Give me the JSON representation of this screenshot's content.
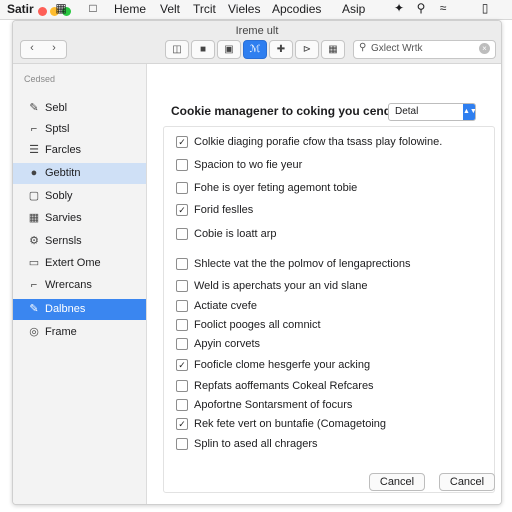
{
  "menubar": {
    "app_name": "Satir",
    "traffic_colors": [
      "#fe5f57",
      "#febc2e",
      "#28c840"
    ],
    "items": [
      "Heme",
      "Velt",
      "Trcit",
      "Vieles",
      "Apcodies",
      "Asip"
    ]
  },
  "window": {
    "title": "Ireme ult",
    "search_placeholder": "Gxlect Wrtk"
  },
  "sidebar": {
    "header": "Cedsed",
    "items": [
      {
        "label": "Sebl",
        "icon": "pencil-icon"
      },
      {
        "label": "Sptsl",
        "icon": "bracket-icon"
      },
      {
        "label": "Farcles",
        "icon": "list-icon"
      },
      {
        "label": "Gebtitn",
        "icon": "circle-icon"
      },
      {
        "label": "Sobly",
        "icon": "square-icon"
      },
      {
        "label": "Sarvies",
        "icon": "grid-icon"
      },
      {
        "label": "Sernsls",
        "icon": "gear-icon"
      },
      {
        "label": "Extert Ome",
        "icon": "document-icon"
      },
      {
        "label": "Wrercans",
        "icon": "bracket-icon"
      },
      {
        "label": "Dalbnes",
        "icon": "pencil-icon"
      },
      {
        "label": "Frame",
        "icon": "globe-icon"
      }
    ],
    "soft_selected_index": 3,
    "selected_index": 9
  },
  "main": {
    "heading": "Cookie managener to coking you cend",
    "dropdown_value": "Detal",
    "options": [
      {
        "label": "Colkie diaging porafie cfow tha tsass play folowine.",
        "checked": true
      },
      {
        "label": "Spacion to wo fie yeur",
        "checked": false
      },
      {
        "label": "Fohe is oyer feting agemont tobie",
        "checked": false
      },
      {
        "label": "Forid feslles",
        "checked": true
      },
      {
        "label": "Cobie is loatt arp",
        "checked": false
      },
      {
        "label": "Shlecte vat the the polmov of lengaprections",
        "checked": false
      },
      {
        "label": "Weld is aperchats your an vid slane",
        "checked": false
      },
      {
        "label": "Actiate cvefe",
        "checked": false
      },
      {
        "label": "Foolict pooges all comnict",
        "checked": false
      },
      {
        "label": "Apyin corvets",
        "checked": false
      },
      {
        "label": "Fooficle clome hesgerfe your acking",
        "checked": true
      },
      {
        "label": "Repfats aoffemants Cokeal Refcares",
        "checked": false
      },
      {
        "label": "Apofortne Sontarsment of focurs",
        "checked": false
      },
      {
        "label": "Rek fete vert on buntafie (Comagetoing",
        "checked": true
      },
      {
        "label": "Splin to ased all chragers",
        "checked": false
      }
    ],
    "cancel_label_1": "Cancel",
    "cancel_label_2": "Cancel"
  }
}
